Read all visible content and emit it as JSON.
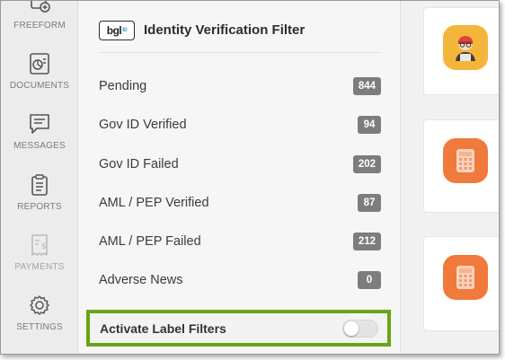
{
  "sidebar": {
    "items": [
      {
        "label": "FREEFORM",
        "icon": "freeform-icon"
      },
      {
        "label": "DOCUMENTS",
        "icon": "documents-icon"
      },
      {
        "label": "MESSAGES",
        "icon": "messages-icon"
      },
      {
        "label": "REPORTS",
        "icon": "reports-icon"
      },
      {
        "label": "PAYMENTS",
        "icon": "payments-icon",
        "disabled": true
      },
      {
        "label": "SETTINGS",
        "icon": "gear-icon"
      }
    ]
  },
  "panel": {
    "logo_text": "bgl",
    "logo_suffix": "ID",
    "title": "Identity Verification Filter",
    "filters": [
      {
        "label": "Pending",
        "count": "844"
      },
      {
        "label": "Gov ID Verified",
        "count": "94"
      },
      {
        "label": "Gov ID Failed",
        "count": "202"
      },
      {
        "label": "AML / PEP Verified",
        "count": "87"
      },
      {
        "label": "AML / PEP Failed",
        "count": "212"
      },
      {
        "label": "Adverse News",
        "count": "0"
      }
    ],
    "label_filter_toggle": {
      "label": "Activate Label Filters",
      "enabled": false
    }
  },
  "cards": [
    {
      "icon": "person-avatar-icon",
      "color": "#f4b63a"
    },
    {
      "icon": "calculator-icon",
      "color": "#f07a3c"
    },
    {
      "icon": "calculator-icon",
      "color": "#f07a3c"
    }
  ],
  "colors": {
    "highlight_border": "#6aa418",
    "badge_bg": "#7d7d7d",
    "orange_icon": "#f07a3c",
    "yellow_icon": "#f4b63a"
  }
}
